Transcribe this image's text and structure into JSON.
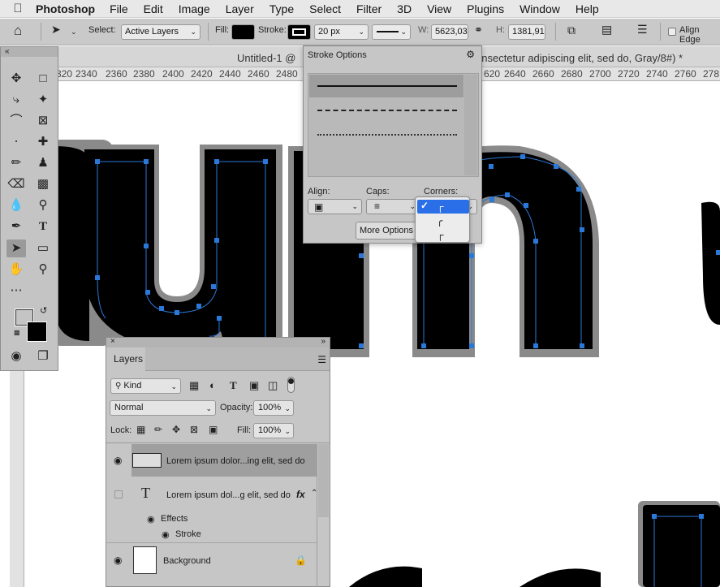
{
  "menubar": {
    "app_name": "Photoshop",
    "items": [
      "File",
      "Edit",
      "Image",
      "Layer",
      "Type",
      "Select",
      "Filter",
      "3D",
      "View",
      "Plugins",
      "Window",
      "Help"
    ]
  },
  "options_bar": {
    "select_label": "Select:",
    "select_value": "Active Layers",
    "fill_label": "Fill:",
    "stroke_label": "Stroke:",
    "stroke_width": "20 px",
    "w_label": "W:",
    "w_value": "5623,03",
    "h_label": "H:",
    "h_value": "1381,91",
    "align_edges_label": "Align Edge"
  },
  "document": {
    "tab_title_left": "Untitled-1 @",
    "tab_title_right": "onsectetur adipiscing elit, sed do, Gray/8#) *"
  },
  "ruler": {
    "ticks_left": [
      "320",
      "2340",
      "2360",
      "2380",
      "2400",
      "2420",
      "2440",
      "2460",
      "2480"
    ],
    "ticks_right": [
      "620",
      "2640",
      "2660",
      "2680",
      "2700",
      "2720",
      "2740",
      "2760",
      "278"
    ]
  },
  "stroke_options": {
    "title": "Stroke Options",
    "align_label": "Align:",
    "caps_label": "Caps:",
    "corners_label": "Corners:",
    "more_options_label": "More Options",
    "corner_options": [
      "miter-join",
      "round-join",
      "bevel-join"
    ],
    "selected_corner": 0
  },
  "layers_panel": {
    "tab_label": "Layers",
    "filter_value": "Kind",
    "blend_mode": "Normal",
    "opacity_label": "Opacity:",
    "opacity_value": "100%",
    "lock_label": "Lock:",
    "fill_label": "Fill:",
    "fill_value": "100%",
    "layers": [
      {
        "name": "Lorem ipsum dolor...ing elit, sed do",
        "kind": "shape",
        "visible": true,
        "selected": true
      },
      {
        "name": "Lorem ipsum dol...g elit, sed do",
        "kind": "text",
        "visible": false,
        "selected": false,
        "fx": "fx"
      },
      {
        "name": "Background",
        "kind": "background",
        "visible": true,
        "selected": false
      }
    ],
    "effects_label": "Effects",
    "stroke_effect_label": "Stroke"
  },
  "colors": {
    "path_blue": "#2a78d8",
    "selection_blue": "#2a6ee8",
    "foreground": "#4a4a4a",
    "background": "#000000"
  }
}
